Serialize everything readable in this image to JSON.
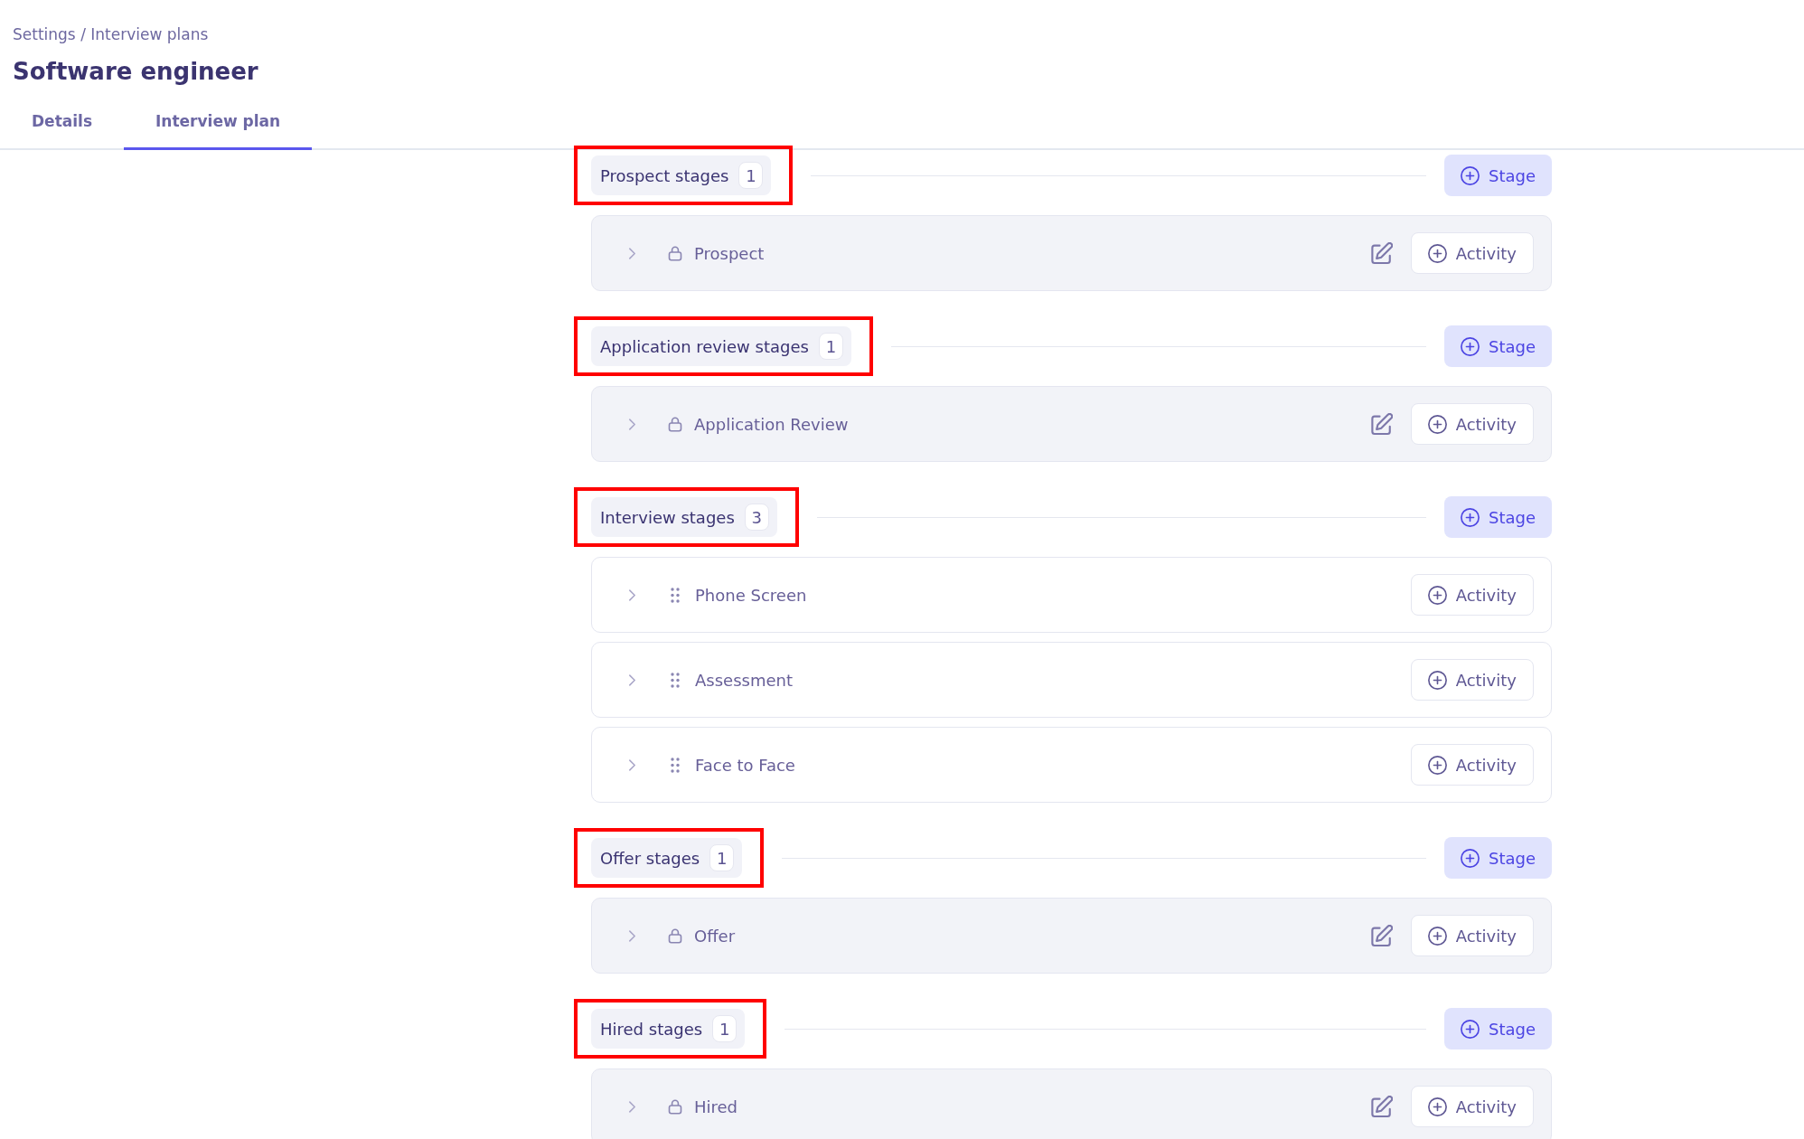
{
  "breadcrumb": "Settings / Interview plans",
  "title": "Software engineer",
  "tabs": [
    {
      "label": "Details",
      "selected": false
    },
    {
      "label": "Interview plan",
      "selected": true
    }
  ],
  "groups": [
    {
      "title": "Prospect stages",
      "count": "1",
      "highlighted": true,
      "add_button": "Stage",
      "stages": [
        {
          "kind": "locked",
          "name": "Prospect",
          "expanded": false,
          "button": "Activity"
        }
      ]
    },
    {
      "title": "Application review stages",
      "count": "1",
      "highlighted": true,
      "add_button": "Stage",
      "stages": [
        {
          "kind": "locked",
          "name": "Application Review",
          "expanded": false,
          "button": "Activity"
        }
      ]
    },
    {
      "title": "Interview stages",
      "count": "3",
      "highlighted": true,
      "add_button": "Stage",
      "stages": [
        {
          "kind": "draggable",
          "name": "Phone Screen",
          "expanded": false,
          "button": "Activity"
        },
        {
          "kind": "draggable",
          "name": "Assessment",
          "expanded": false,
          "button": "Activity"
        },
        {
          "kind": "draggable",
          "name": "Face to Face",
          "expanded": false,
          "button": "Activity"
        }
      ]
    },
    {
      "title": "Offer stages",
      "count": "1",
      "highlighted": true,
      "add_button": "Stage",
      "stages": [
        {
          "kind": "locked",
          "name": "Offer",
          "expanded": false,
          "button": "Activity"
        }
      ]
    },
    {
      "title": "Hired stages",
      "count": "1",
      "highlighted": true,
      "add_button": "Stage",
      "stages": [
        {
          "kind": "locked",
          "name": "Hired",
          "expanded": false,
          "button": "Activity"
        }
      ]
    }
  ]
}
